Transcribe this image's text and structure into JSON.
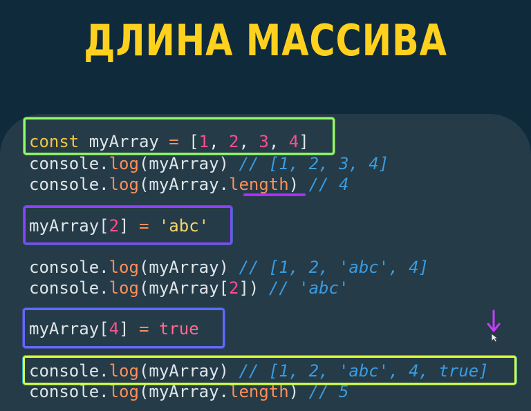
{
  "title": "ДЛИНА МАССИВА",
  "code": {
    "l1": {
      "const": "const",
      "name": " myArray ",
      "eq": "=",
      "open": " [",
      "n1": "1",
      "c1": ", ",
      "n2": "2",
      "c2": ", ",
      "n3": "3",
      "c3": ", ",
      "n4": "4",
      "close": "]"
    },
    "l2": {
      "console": "console.",
      "log": "log",
      "args": "(myArray) ",
      "comment": "// [1, 2, 3, 4]"
    },
    "l3": {
      "console": "console.",
      "log": "log",
      "args": "(myArray.",
      "length": "length",
      "close": ") ",
      "comment": "// 4"
    },
    "l4": {
      "name": "myArray[",
      "idx": "2",
      "close": "] ",
      "eq": "=",
      "space": " ",
      "value": "'abc'"
    },
    "l5": {
      "console": "console.",
      "log": "log",
      "args": "(myArray) ",
      "comment": "// [1, 2, 'abc', 4]"
    },
    "l6": {
      "console": "console.",
      "log": "log",
      "args": "(myArray[",
      "idx": "2",
      "close": "]) ",
      "comment": "// 'abc'"
    },
    "l7": {
      "name": "myArray[",
      "idx": "4",
      "close": "] ",
      "eq": "=",
      "space": " ",
      "value": "true"
    },
    "l8": {
      "console": "console.",
      "log": "log",
      "args": "(myArray) ",
      "comment": "// [1, 2, 'abc', 4, true]"
    },
    "l9": {
      "console": "console.",
      "log": "log",
      "args": "(myArray.",
      "length": "length",
      "close": ") ",
      "comment": "// 5"
    }
  },
  "colors": {
    "background": "#0f2b3b",
    "panel": "#253b48",
    "title": "#ffd11f",
    "keyword": "#f2c641",
    "function": "#ff8f5a",
    "number": "#ff4f8e",
    "string": "#f7d46a",
    "comment": "#3a9ce0"
  },
  "icons": {
    "arrow": "arrow-down-icon",
    "cursor": "mouse-cursor-icon"
  }
}
